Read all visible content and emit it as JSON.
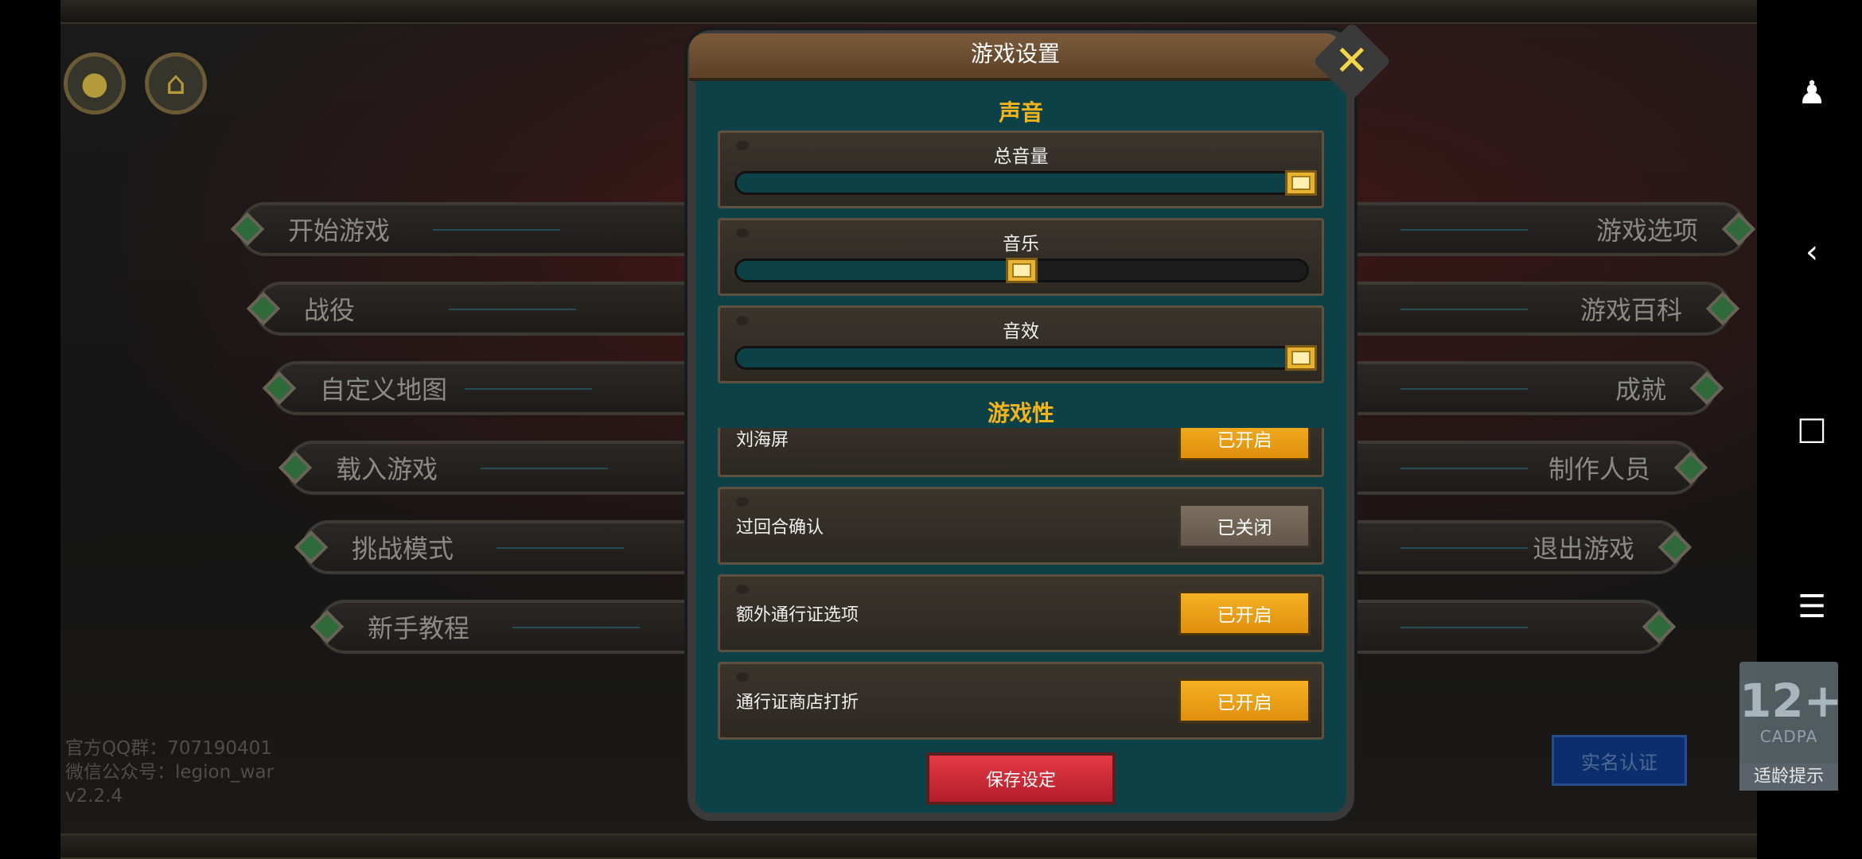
{
  "menu_left": [
    {
      "label": "开始游戏"
    },
    {
      "label": "战役"
    },
    {
      "label": "自定义地图"
    },
    {
      "label": "载入游戏"
    },
    {
      "label": "挑战模式"
    },
    {
      "label": "新手教程"
    }
  ],
  "menu_right": [
    {
      "label": "游戏选项"
    },
    {
      "label": "游戏百科"
    },
    {
      "label": "成就"
    },
    {
      "label": "制作人员"
    },
    {
      "label": "退出游戏"
    },
    {
      "label": ""
    }
  ],
  "footer": {
    "qq": "官方QQ群：707190401",
    "wechat": "微信公众号：legion_war",
    "version": "v2.2.4"
  },
  "auth_button": "实名认证",
  "age_badge": {
    "rating": "12+",
    "org": "CADPA",
    "tip": "适龄提示"
  },
  "top_icons": [
    "profile-icon",
    "shop-icon"
  ],
  "system_icons": [
    "accessibility-icon",
    "back-icon",
    "recent-apps-icon",
    "menu-icon"
  ],
  "dialog": {
    "title": "游戏设置",
    "sound_section": "声音",
    "sliders": [
      {
        "label": "总音量",
        "value": 1.0
      },
      {
        "label": "音乐",
        "value": 0.5
      },
      {
        "label": "音效",
        "value": 1.0
      }
    ],
    "gameplay_section": "游戏性",
    "options": [
      {
        "label": "刘海屏",
        "state": "已开启",
        "on": true
      },
      {
        "label": "过回合确认",
        "state": "已关闭",
        "on": false
      },
      {
        "label": "额外通行证选项",
        "state": "已开启",
        "on": true
      },
      {
        "label": "通行证商店打折",
        "state": "已开启",
        "on": true
      }
    ],
    "save_label": "保存设定"
  },
  "colors": {
    "accent_gold": "#f2b41c",
    "toggle_on": "#f0a11a",
    "toggle_off": "#706454",
    "save_red": "#d02c38",
    "panel_teal": "#0d4148"
  }
}
